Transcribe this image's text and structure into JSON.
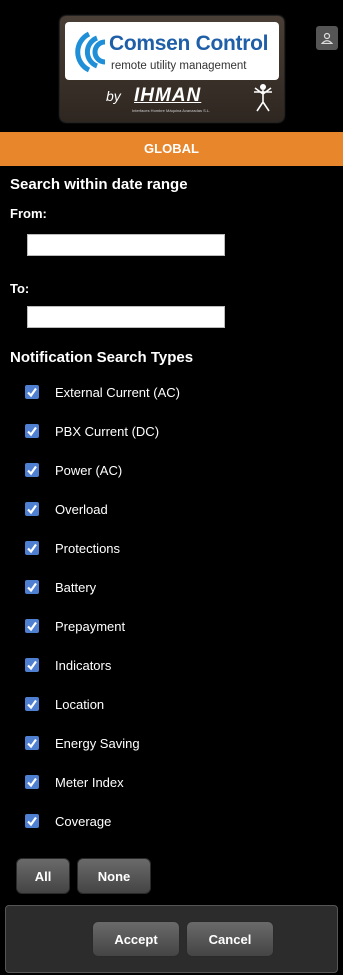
{
  "logo": {
    "title": "Comsen Control",
    "subtitle": "remote utility management",
    "by": "by",
    "brand": "IHMAN",
    "tagline": "Interfaces Hombre Máquina Avanzadas S.L."
  },
  "header": {
    "section_label": "GLOBAL"
  },
  "date_range": {
    "title": "Search within date range",
    "from_label": "From:",
    "from_value": "",
    "to_label": "To:",
    "to_value": ""
  },
  "notifications": {
    "title": "Notification Search Types",
    "items": [
      {
        "label": "External Current (AC)",
        "checked": true
      },
      {
        "label": "PBX Current (DC)",
        "checked": true
      },
      {
        "label": "Power (AC)",
        "checked": true
      },
      {
        "label": "Overload",
        "checked": true
      },
      {
        "label": "Protections",
        "checked": true
      },
      {
        "label": "Battery",
        "checked": true
      },
      {
        "label": "Prepayment",
        "checked": true
      },
      {
        "label": "Indicators",
        "checked": true
      },
      {
        "label": "Location",
        "checked": true
      },
      {
        "label": "Energy Saving",
        "checked": true
      },
      {
        "label": "Meter Index",
        "checked": true
      },
      {
        "label": "Coverage",
        "checked": true
      }
    ]
  },
  "selection_buttons": {
    "all_label": "All",
    "none_label": "None"
  },
  "footer": {
    "accept_label": "Accept",
    "cancel_label": "Cancel"
  },
  "colors": {
    "accent": "#e8862c",
    "checkbox": "#4f7fd0",
    "background": "#000000"
  }
}
